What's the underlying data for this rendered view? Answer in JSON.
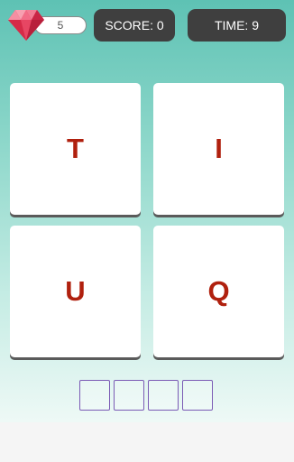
{
  "hud": {
    "gems": "5",
    "score": "SCORE: 0",
    "time": "TIME: 9"
  },
  "tiles": [
    "T",
    "I",
    "U",
    "Q"
  ],
  "answer": {
    "slots": [
      "",
      "",
      "",
      ""
    ]
  },
  "colors": {
    "letter": "#b0200e",
    "hud_bg": "#3f3f3f",
    "gem": "#e0344f",
    "slot_border": "#7b5bb5"
  },
  "icons": {
    "gem": "ruby-gem-icon"
  }
}
